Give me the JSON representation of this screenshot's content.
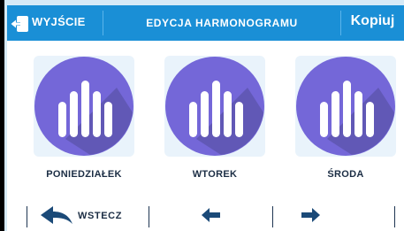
{
  "header": {
    "exit_label": "WYJŚCIE",
    "title": "EDYCJA HARMONOGRAMU",
    "copy_label": "Kopiuj"
  },
  "days": [
    {
      "label": "PONIEDZIAŁEK",
      "icon": "schedule-bars-icon"
    },
    {
      "label": "WTOREK",
      "icon": "schedule-bars-icon"
    },
    {
      "label": "ŚRODA",
      "icon": "schedule-bars-icon"
    }
  ],
  "footer": {
    "back_label": "WSTECZ",
    "prev_icon": "arrow-left-icon",
    "next_icon": "arrow-right-icon"
  },
  "colors": {
    "header_bg": "#1a8fd6",
    "circle": "#7467d8",
    "circle_shadow": "#5a52a8",
    "icon_dark": "#1b4a78",
    "text_dark": "#1b2d44",
    "background": "#d6eaf7"
  }
}
